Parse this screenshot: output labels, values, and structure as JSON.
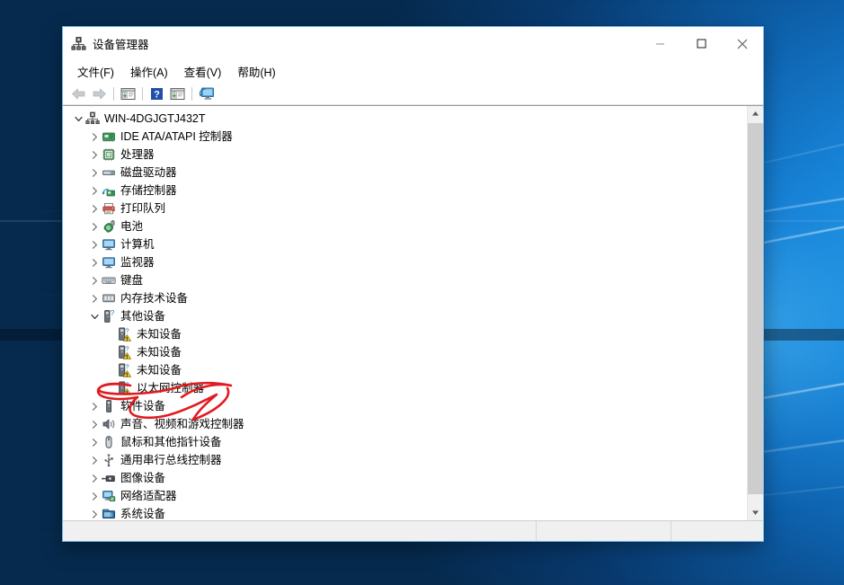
{
  "window": {
    "title": "设备管理器",
    "title_icon": "device-manager-icon",
    "controls": {
      "minimize": "最小化",
      "maximize": "最大化",
      "close": "关闭"
    }
  },
  "menubar": {
    "items": [
      {
        "label": "文件(F)",
        "name": "menu-file"
      },
      {
        "label": "操作(A)",
        "name": "menu-action"
      },
      {
        "label": "查看(V)",
        "name": "menu-view"
      },
      {
        "label": "帮助(H)",
        "name": "menu-help"
      }
    ]
  },
  "toolbar": {
    "buttons": [
      {
        "name": "back-arrow-icon",
        "title": "后退"
      },
      {
        "name": "forward-arrow-icon",
        "title": "前进"
      },
      {
        "name": "show-hide-console-tree-icon",
        "title": "显示/隐藏控制台树"
      },
      {
        "name": "help-question-icon",
        "title": "帮助"
      },
      {
        "name": "properties-icon",
        "title": "属性"
      },
      {
        "name": "scan-hardware-changes-icon",
        "title": "扫描检测硬件改动"
      }
    ]
  },
  "tree": {
    "root": {
      "label": "WIN-4DGJGTJ432T",
      "icon": "computer-tower-icon",
      "expanded": true,
      "indent": 0
    },
    "nodes": [
      {
        "label": "IDE ATA/ATAPI 控制器",
        "icon": "ide-controller-icon",
        "indent": 1,
        "state": "collapsed"
      },
      {
        "label": "处理器",
        "icon": "processor-icon",
        "indent": 1,
        "state": "collapsed"
      },
      {
        "label": "磁盘驱动器",
        "icon": "disk-drive-icon",
        "indent": 1,
        "state": "collapsed"
      },
      {
        "label": "存储控制器",
        "icon": "storage-controller-icon",
        "indent": 1,
        "state": "collapsed"
      },
      {
        "label": "打印队列",
        "icon": "printer-icon",
        "indent": 1,
        "state": "collapsed"
      },
      {
        "label": "电池",
        "icon": "battery-icon",
        "indent": 1,
        "state": "collapsed"
      },
      {
        "label": "计算机",
        "icon": "monitor-icon",
        "indent": 1,
        "state": "collapsed"
      },
      {
        "label": "监视器",
        "icon": "monitor-icon",
        "indent": 1,
        "state": "collapsed"
      },
      {
        "label": "键盘",
        "icon": "keyboard-icon",
        "indent": 1,
        "state": "collapsed"
      },
      {
        "label": "内存技术设备",
        "icon": "memory-device-icon",
        "indent": 1,
        "state": "collapsed"
      },
      {
        "label": "其他设备",
        "icon": "unknown-device-icon",
        "indent": 1,
        "state": "expanded"
      },
      {
        "label": "未知设备",
        "icon": "unknown-device-warning-icon",
        "indent": 2,
        "state": "leaf"
      },
      {
        "label": "未知设备",
        "icon": "unknown-device-warning-icon",
        "indent": 2,
        "state": "leaf"
      },
      {
        "label": "未知设备",
        "icon": "unknown-device-warning-icon",
        "indent": 2,
        "state": "leaf"
      },
      {
        "label": "以太网控制器",
        "icon": "unknown-device-warning-icon",
        "indent": 2,
        "state": "leaf",
        "annotated": true
      },
      {
        "label": "软件设备",
        "icon": "software-device-icon",
        "indent": 1,
        "state": "collapsed"
      },
      {
        "label": "声音、视频和游戏控制器",
        "icon": "sound-icon",
        "indent": 1,
        "state": "collapsed"
      },
      {
        "label": "鼠标和其他指针设备",
        "icon": "mouse-icon",
        "indent": 1,
        "state": "collapsed"
      },
      {
        "label": "通用串行总线控制器",
        "icon": "usb-icon",
        "indent": 1,
        "state": "collapsed"
      },
      {
        "label": "图像设备",
        "icon": "imaging-device-icon",
        "indent": 1,
        "state": "collapsed"
      },
      {
        "label": "网络适配器",
        "icon": "network-adapter-icon",
        "indent": 1,
        "state": "collapsed"
      },
      {
        "label": "系统设备",
        "icon": "system-device-icon",
        "indent": 1,
        "state": "collapsed"
      }
    ]
  },
  "scrollbar": {
    "up_arrow": "scroll-up-arrow-icon",
    "down_arrow": "scroll-down-arrow-icon"
  },
  "statusbar": {
    "segments": [
      "",
      "",
      ""
    ]
  },
  "annotation": {
    "color": "#e01b20",
    "shape": "hand-drawn-ellipse",
    "target": "以太网控制器"
  }
}
